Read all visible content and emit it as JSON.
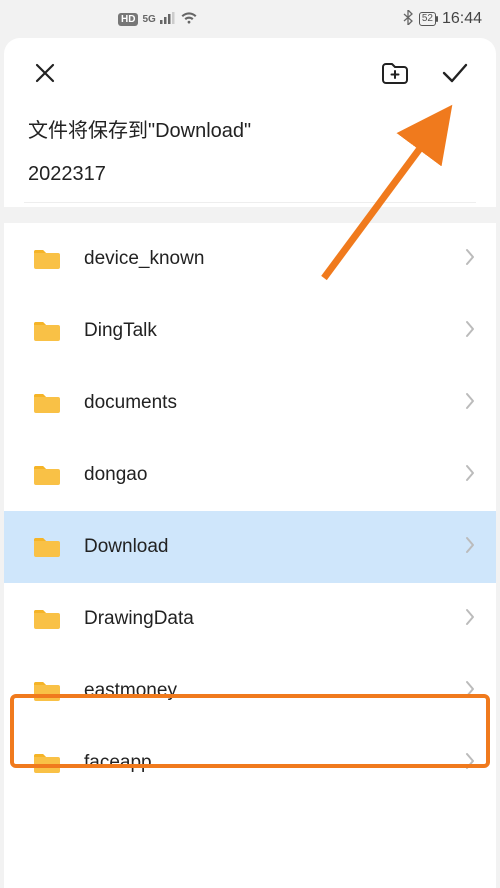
{
  "status": {
    "hd": "HD",
    "network": "5G",
    "battery": "52",
    "time": "16:44"
  },
  "header": {
    "title": "文件将保存到\"Download\"",
    "filename": "2022317"
  },
  "folders": [
    {
      "name": "device_known",
      "selected": false
    },
    {
      "name": "DingTalk",
      "selected": false
    },
    {
      "name": "documents",
      "selected": false
    },
    {
      "name": "dongao",
      "selected": false
    },
    {
      "name": "Download",
      "selected": true
    },
    {
      "name": "DrawingData",
      "selected": false
    },
    {
      "name": "eastmoney",
      "selected": false
    },
    {
      "name": "faceapp",
      "selected": false
    }
  ],
  "annotation": {
    "highlight_index": 4
  }
}
